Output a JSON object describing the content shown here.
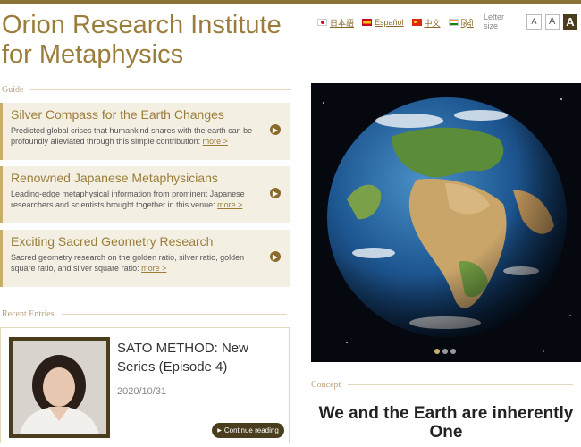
{
  "site": {
    "title": "Orion Research Institute for Metaphysics"
  },
  "languages": [
    {
      "label": "日本語",
      "flag": "jp-flag-icon"
    },
    {
      "label": "Español",
      "flag": "es-flag-icon"
    },
    {
      "label": "中文",
      "flag": "cn-flag-icon"
    },
    {
      "label": "हिंदी",
      "flag": "in-flag-icon"
    }
  ],
  "letter_size": {
    "label": "Letter size",
    "options": [
      "A",
      "A",
      "A"
    ],
    "selected_index": 2
  },
  "guide": {
    "label": "Guide",
    "items": [
      {
        "title": "Silver Compass for the Earth Changes",
        "desc": "Predicted global crises that humankind shares with the earth can be profoundly alleviated through this simple contribution:",
        "more": "more >"
      },
      {
        "title": "Renowned Japanese Metaphysicians",
        "desc": "Leading-edge metaphysical information from prominent Japanese researchers and scientists brought together in this venue:",
        "more": "more >"
      },
      {
        "title": "Exciting Sacred Geometry Research",
        "desc": "Sacred geometry research on the golden ratio, silver ratio, golden square ratio, and silver square ratio:",
        "more": "more >"
      }
    ]
  },
  "recent": {
    "label": "Recent Entries",
    "entry": {
      "title": "SATO METHOD: New Series (Episode 4)",
      "date": "2020/10/31",
      "continue": "Continue reading"
    }
  },
  "slider": {
    "slides": 3,
    "active_index": 0
  },
  "concept": {
    "label": "Concept",
    "text": "We and the Earth are inherently One"
  },
  "colors": {
    "accent": "#9a7d3a",
    "dark": "#4a3d1e",
    "panel": "#f4efe3"
  }
}
